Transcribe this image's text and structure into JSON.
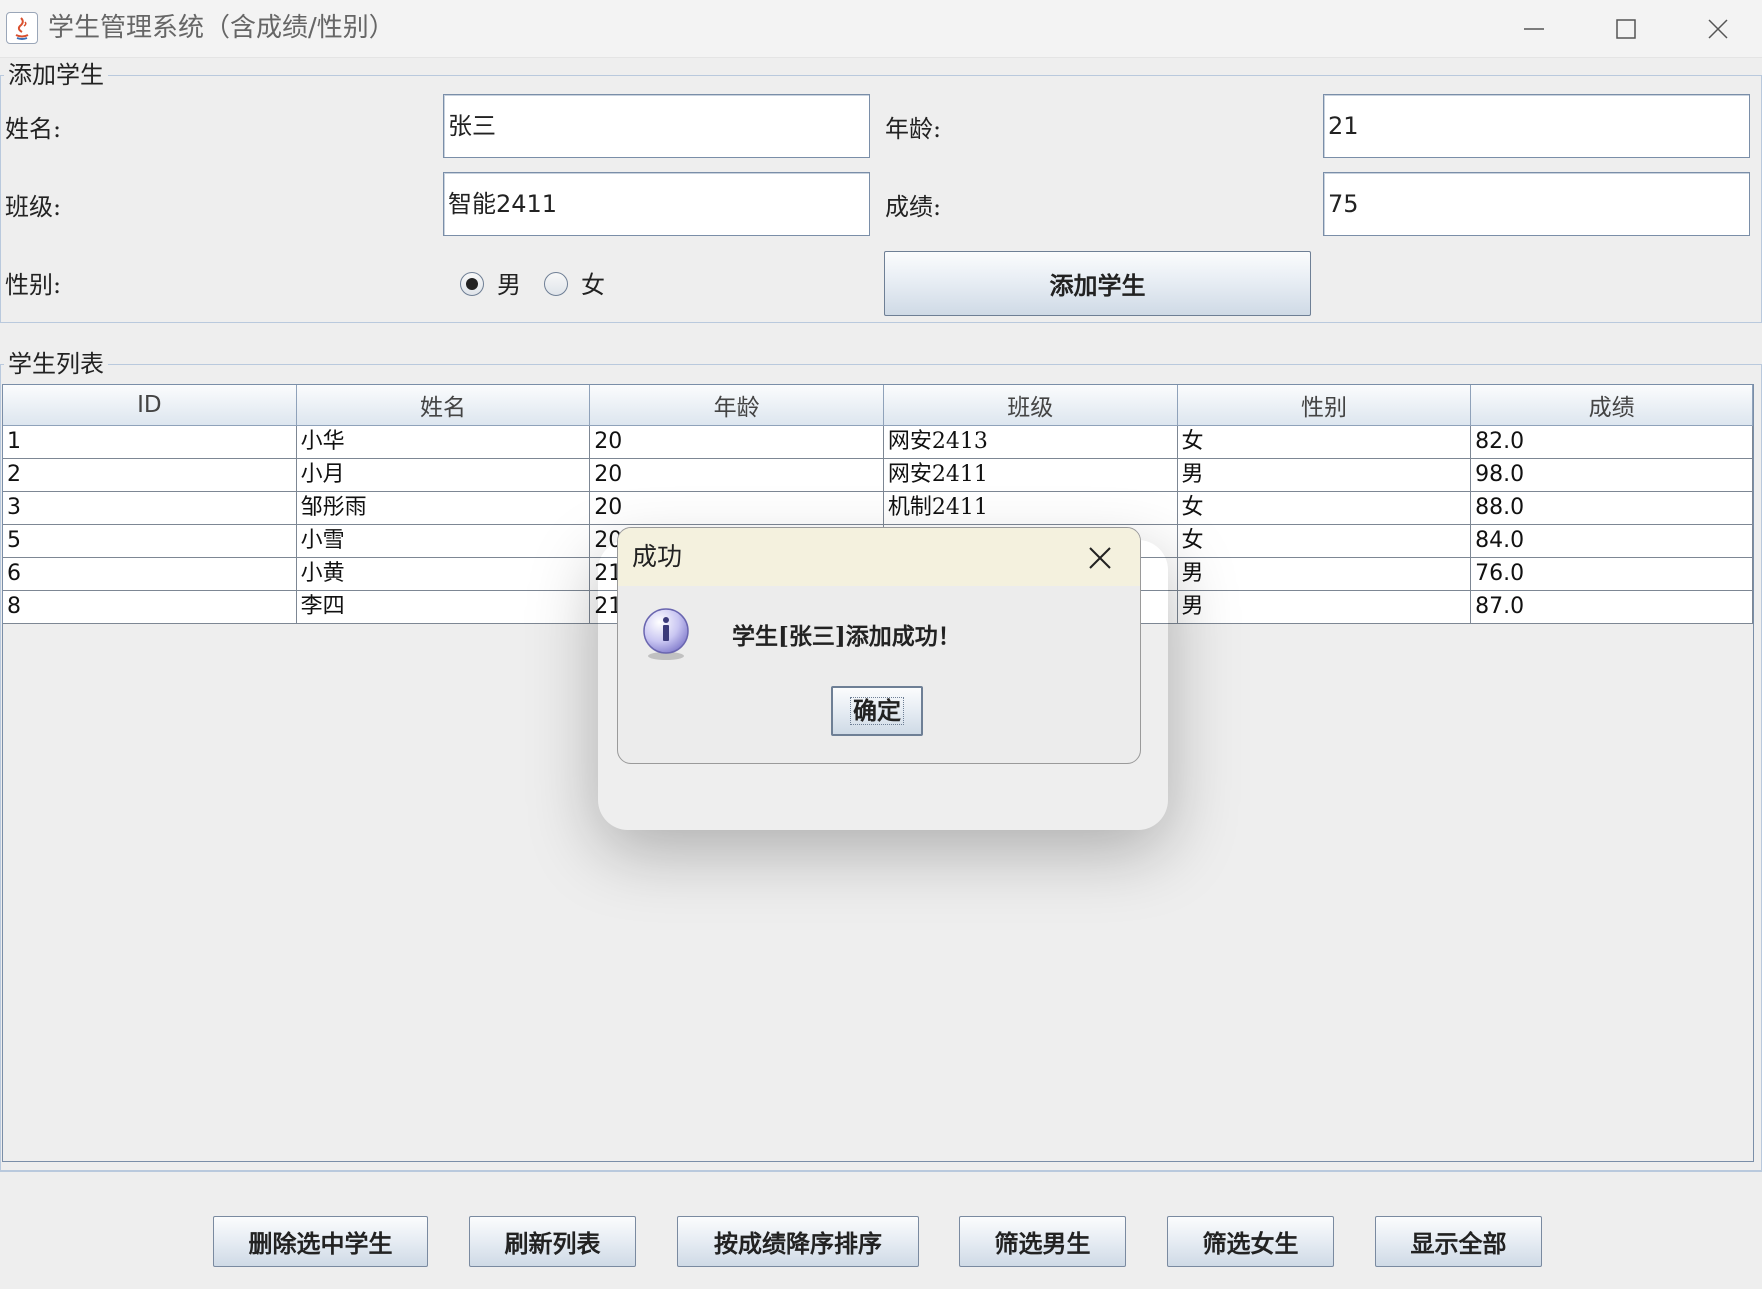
{
  "window": {
    "title": "学生管理系统（含成绩/性别）"
  },
  "add_panel": {
    "title": "添加学生",
    "name_label": "姓名:",
    "name_value": "张三",
    "age_label": "年龄:",
    "age_value": "21",
    "class_label": "班级:",
    "class_value": "智能2411",
    "score_label": "成绩:",
    "score_value": "75",
    "gender_label": "性别:",
    "gender_options": [
      "男",
      "女"
    ],
    "gender_selected": "男",
    "add_button": "添加学生"
  },
  "list_panel": {
    "title": "学生列表",
    "columns": [
      "ID",
      "姓名",
      "年龄",
      "班级",
      "性别",
      "成绩"
    ],
    "rows": [
      [
        "1",
        "小华",
        "20",
        "网安2413",
        "女",
        "82.0"
      ],
      [
        "2",
        "小月",
        "20",
        "网安2411",
        "男",
        "98.0"
      ],
      [
        "3",
        "邹彤雨",
        "20",
        "机制2411",
        "女",
        "88.0"
      ],
      [
        "5",
        "小雪",
        "20",
        "",
        "女",
        "84.0"
      ],
      [
        "6",
        "小黄",
        "21",
        "",
        "男",
        "76.0"
      ],
      [
        "8",
        "李四",
        "21",
        "",
        "男",
        "87.0"
      ]
    ]
  },
  "actions": {
    "delete": "删除选中学生",
    "refresh": "刷新列表",
    "sort_score_desc": "按成绩降序排序",
    "filter_male": "筛选男生",
    "filter_female": "筛选女生",
    "show_all": "显示全部"
  },
  "dialog": {
    "title": "成功",
    "message": "学生[张三]添加成功！",
    "ok": "确定",
    "icon": "info-icon"
  }
}
